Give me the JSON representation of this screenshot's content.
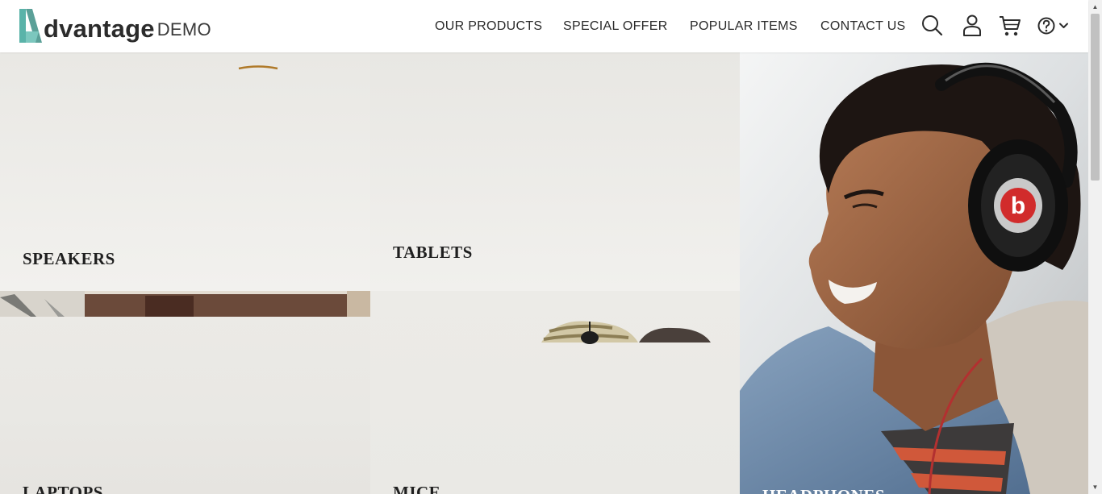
{
  "brand": {
    "name": "dvantage",
    "suffix": "DEMO",
    "accent": "#5ab3a9"
  },
  "nav": {
    "links": [
      "OUR PRODUCTS",
      "SPECIAL OFFER",
      "POPULAR ITEMS",
      "CONTACT US"
    ],
    "icons": [
      "search-icon",
      "user-icon",
      "cart-icon",
      "help-icon",
      "chevron-down-icon"
    ]
  },
  "categories": {
    "speakers": "SPEAKERS",
    "tablets": "TABLETS",
    "laptops": "LAPTOPS",
    "mice": "MICE",
    "headphones": "HEADPHONES"
  },
  "colors": {
    "text": "#2b2b2b",
    "tile_bg": "#ebeae6"
  }
}
